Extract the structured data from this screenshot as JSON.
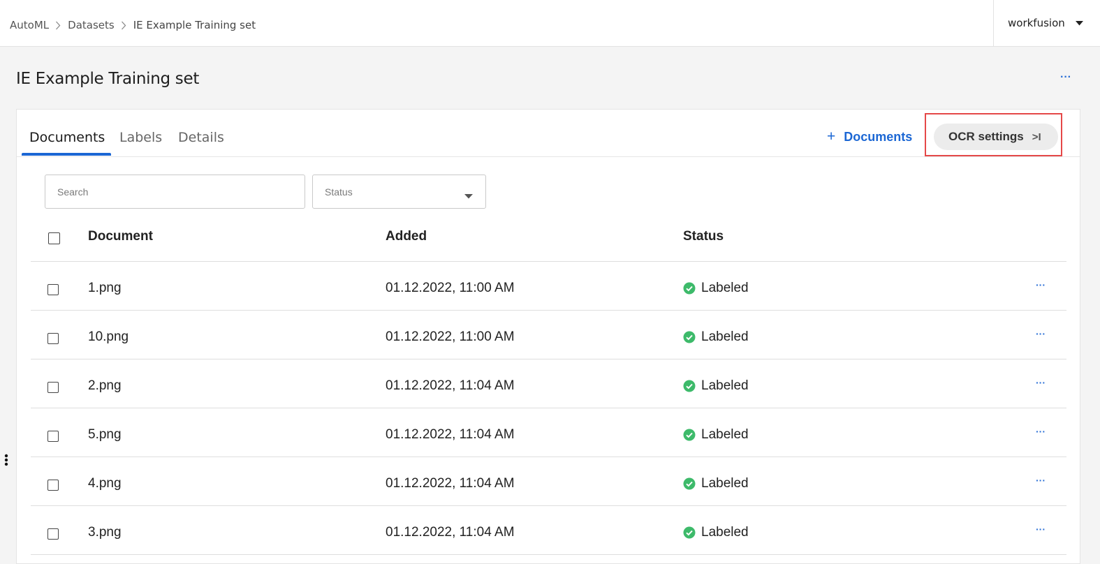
{
  "breadcrumb": {
    "items": [
      "AutoML",
      "Datasets"
    ],
    "current": "IE Example Training set"
  },
  "user": {
    "name": "workfusion"
  },
  "page": {
    "title": "IE Example Training set",
    "more": "···"
  },
  "tabs": [
    {
      "label": "Documents",
      "active": true
    },
    {
      "label": "Labels",
      "active": false
    },
    {
      "label": "Details",
      "active": false
    }
  ],
  "actions": {
    "add_documents_plus": "+",
    "add_documents": "Documents",
    "ocr_settings": "OCR settings",
    "ocr_chevron": ">I"
  },
  "filters": {
    "search_placeholder": "Search",
    "status_placeholder": "Status"
  },
  "table": {
    "columns": [
      "Document",
      "Added",
      "Status"
    ],
    "rows": [
      {
        "document": "1.png",
        "added": "01.12.2022, 11:00 AM",
        "status": "Labeled",
        "more": "···"
      },
      {
        "document": "10.png",
        "added": "01.12.2022, 11:00 AM",
        "status": "Labeled",
        "more": "···"
      },
      {
        "document": "2.png",
        "added": "01.12.2022, 11:04 AM",
        "status": "Labeled",
        "more": "···"
      },
      {
        "document": "5.png",
        "added": "01.12.2022, 11:04 AM",
        "status": "Labeled",
        "more": "···"
      },
      {
        "document": "4.png",
        "added": "01.12.2022, 11:04 AM",
        "status": "Labeled",
        "more": "···"
      },
      {
        "document": "3.png",
        "added": "01.12.2022, 11:04 AM",
        "status": "Labeled",
        "more": "···"
      }
    ]
  },
  "colors": {
    "accent": "#1c67d4",
    "status_ok": "#3dba6a",
    "highlight": "#e54848"
  },
  "icons": {
    "breadcrumb_separator": "chevron-right-icon",
    "user_menu": "caret-down-icon",
    "status_dropdown": "caret-down-icon",
    "status_ok": "check-circle-icon",
    "row_menu": "more-horizontal-icon",
    "side_handle": "more-vertical-icon"
  }
}
